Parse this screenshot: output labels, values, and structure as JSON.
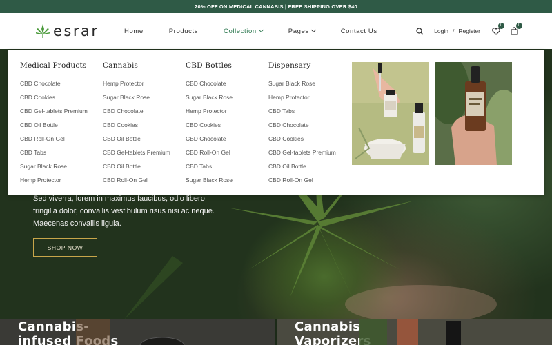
{
  "topbar": {
    "text": "20% OFF ON MEDICAL CANNABIS | FREE SHIPPING OVER $40"
  },
  "brand": {
    "name": "esrar"
  },
  "nav": [
    {
      "label": "Home",
      "dropdown": false
    },
    {
      "label": "Products",
      "dropdown": false
    },
    {
      "label": "Collection",
      "dropdown": true,
      "active": true
    },
    {
      "label": "Pages",
      "dropdown": true
    },
    {
      "label": "Contact Us",
      "dropdown": false
    }
  ],
  "header": {
    "login": "Login",
    "separator": "/",
    "register": "Register",
    "wishlist_count": "0",
    "cart_count": "0"
  },
  "mega_menu": {
    "columns": [
      {
        "title": "Medical Products",
        "links": [
          "CBD Chocolate",
          "CBD Cookies",
          "CBD Gel-tablets Premium",
          "CBD Oil Bottle",
          "CBD Roll-On Gel",
          "CBD Tabs",
          "Sugar Black Rose",
          "Hemp Protector"
        ]
      },
      {
        "title": "Cannabis",
        "links": [
          "Hemp Protector",
          "Sugar Black Rose",
          "CBD Chocolate",
          "CBD Cookies",
          "CBD Oil Bottle",
          "CBD Gel-tablets Premium",
          "CBD Oil Bottle",
          "CBD Roll-On Gel"
        ]
      },
      {
        "title": "CBD Bottles",
        "links": [
          "CBD Chocolate",
          "Sugar Black Rose",
          "Hemp Protector",
          "CBD Cookies",
          "CBD Chocolate",
          "CBD Roll-On Gel",
          "CBD Tabs",
          "Sugar Black Rose"
        ]
      },
      {
        "title": "Dispensary",
        "links": [
          "Sugar Black Rose",
          "Hemp Protector",
          "CBD Tabs",
          "CBD Chocolate",
          "CBD Cookies",
          "CBD Gel-tablets Premium",
          "CBD Oil Bottle",
          "CBD Roll-On Gel"
        ]
      }
    ]
  },
  "hero": {
    "text_line1": "Sed viverra, lorem in maximus faucibus, odio libero",
    "text_line2": "fringilla dolor, convallis vestibulum risus nisi ac neque.",
    "text_line3": "Maecenas convallis ligula.",
    "button": "SHOP NOW"
  },
  "categories": [
    {
      "line1": "Cannabis-",
      "line2": "infused Foods"
    },
    {
      "line1": "Cannabis",
      "line2": "Vaporizers"
    }
  ],
  "colors": {
    "brand_green": "#2f5a46",
    "accent_gold": "#c8a64a",
    "active_nav": "#2f7a52"
  }
}
